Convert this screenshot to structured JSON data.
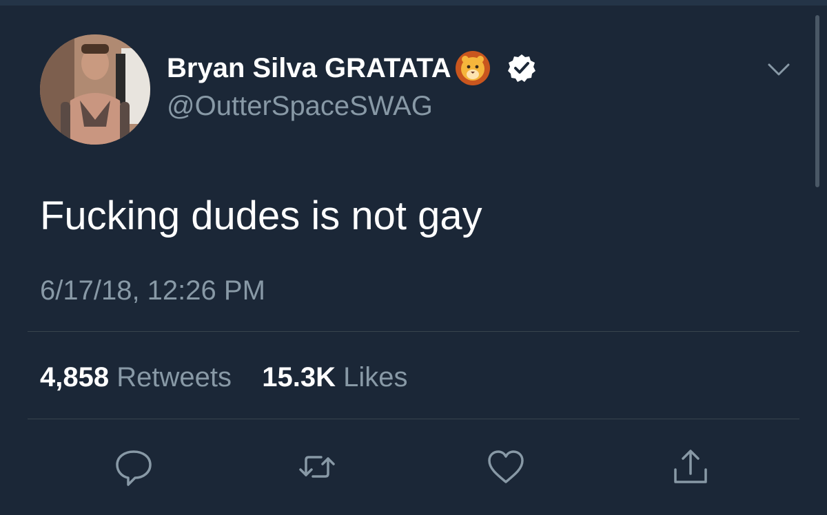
{
  "tweet": {
    "display_name": "Bryan Silva GRATATA",
    "name_emoji": "lion-icon",
    "verified_badge": "verified-icon",
    "handle": "@OutterSpaceSWAG",
    "text": "Fucking dudes is not gay",
    "timestamp": "6/17/18, 12:26 PM",
    "stats": {
      "retweets_count": "4,858",
      "retweets_label": "Retweets",
      "likes_count": "15.3K",
      "likes_label": "Likes"
    },
    "actions": [
      "reply-icon",
      "retweet-icon",
      "like-icon",
      "share-icon"
    ]
  },
  "colors": {
    "background": "#1b2737",
    "primary_text": "#ffffff",
    "secondary_text": "#8899a6",
    "divider": "#38444d"
  }
}
